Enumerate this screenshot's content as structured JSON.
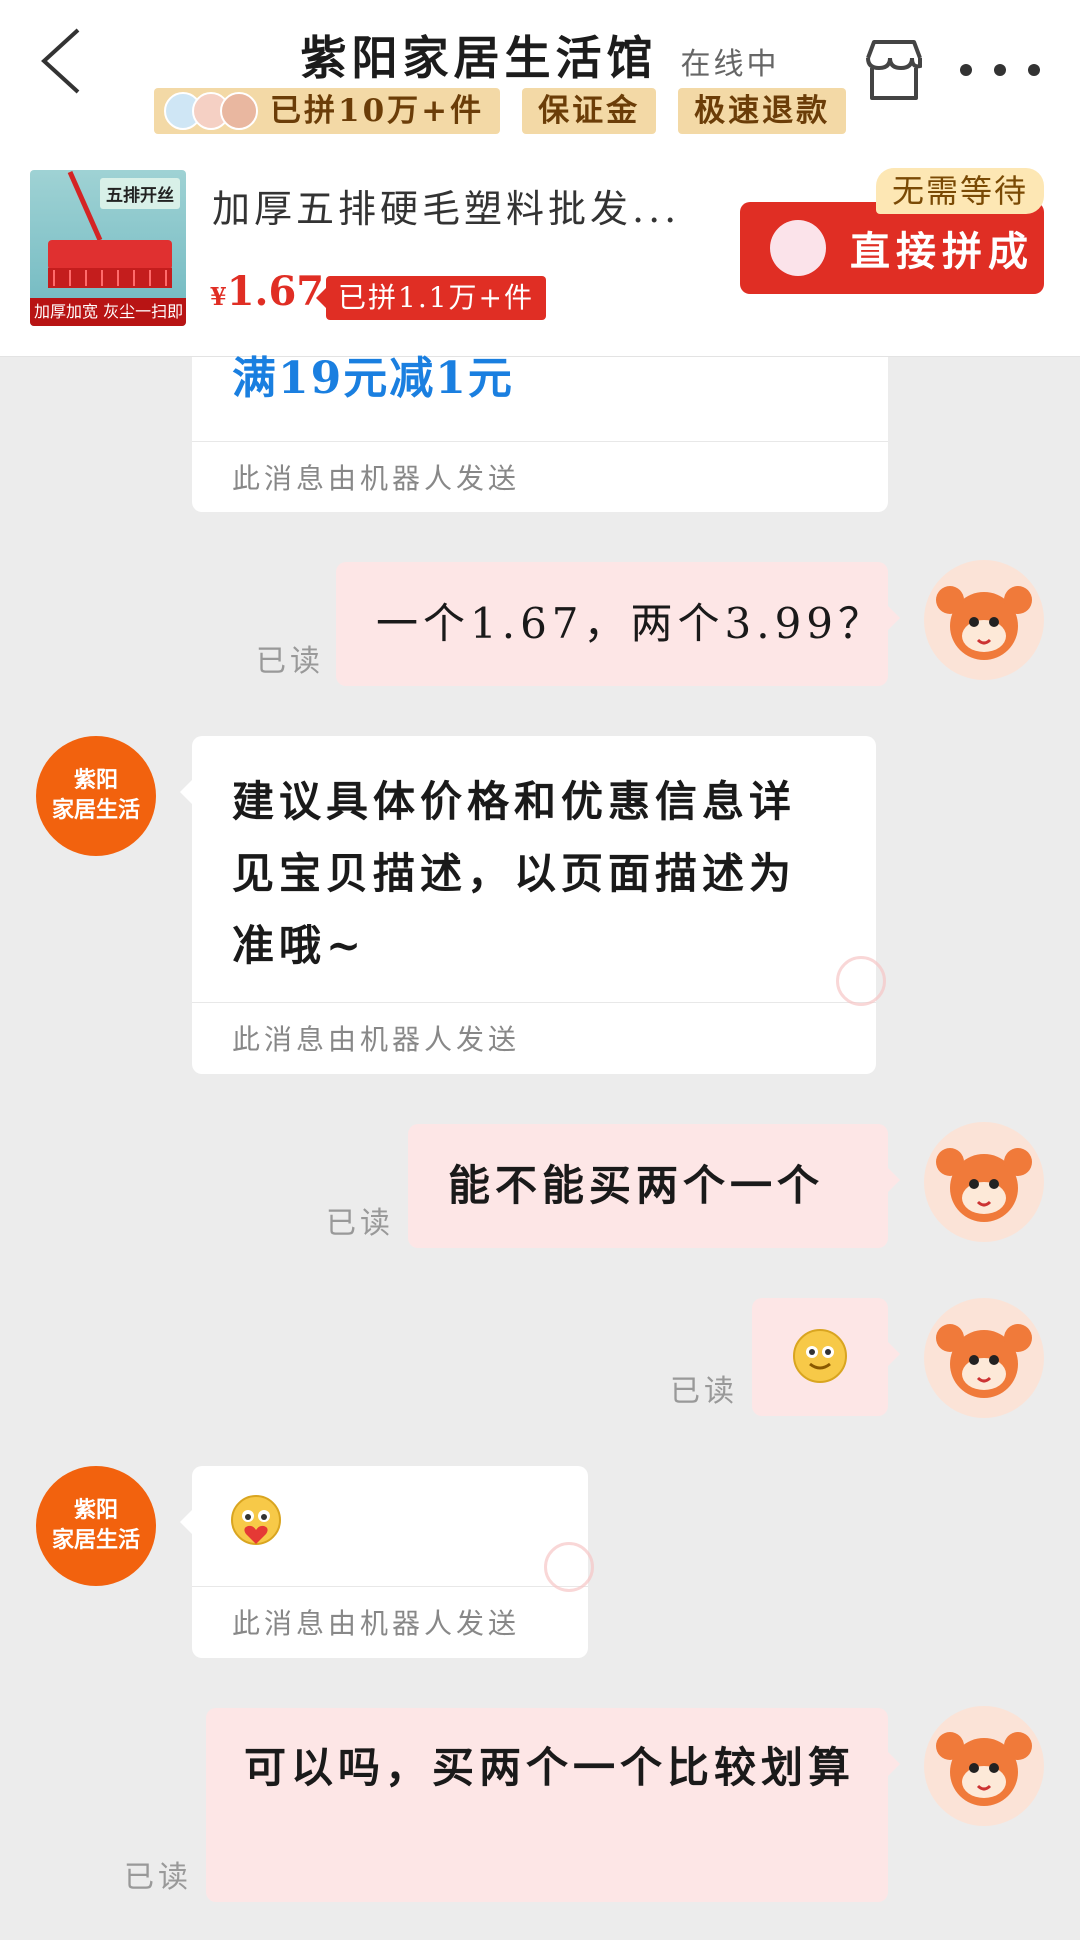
{
  "header": {
    "title": "紫阳家居生活馆",
    "status": "在线中",
    "badges": [
      "已拼10万+件",
      "保证金",
      "极速退款"
    ]
  },
  "product": {
    "thumb_tag": "五排开丝",
    "thumb_footer": "加厚加宽 灰尘一扫即净",
    "title": "加厚五排硬毛塑料批发...",
    "currency": "¥",
    "price": "1.67",
    "sold_tag": "已拼1.1万+件",
    "join_button": "直接拼成",
    "no_wait_badge": "无需等待"
  },
  "chat": {
    "promo_text": "满19元减1元",
    "robot_note": "此消息由机器人发送",
    "read_label": "已读",
    "shop_avatar_lines": [
      "紫阳",
      "家居生活"
    ],
    "messages": [
      {
        "from": "user",
        "text": "一个1.67，两个3.99？"
      },
      {
        "from": "shop",
        "text": "建议具体价格和优惠信息详见宝贝描述，以页面描述为准哦~"
      },
      {
        "from": "user",
        "text": "能不能买两个一个"
      },
      {
        "from": "user",
        "emoji": "smile"
      },
      {
        "from": "shop",
        "emoji": "heart-hug"
      },
      {
        "from": "user",
        "text": "可以吗，买两个一个比较划算"
      }
    ]
  },
  "colors": {
    "accent_red": "#e02e24",
    "shop_orange": "#f2620e",
    "promo_blue": "#1a7fe0",
    "user_bubble": "#fde6e6"
  }
}
